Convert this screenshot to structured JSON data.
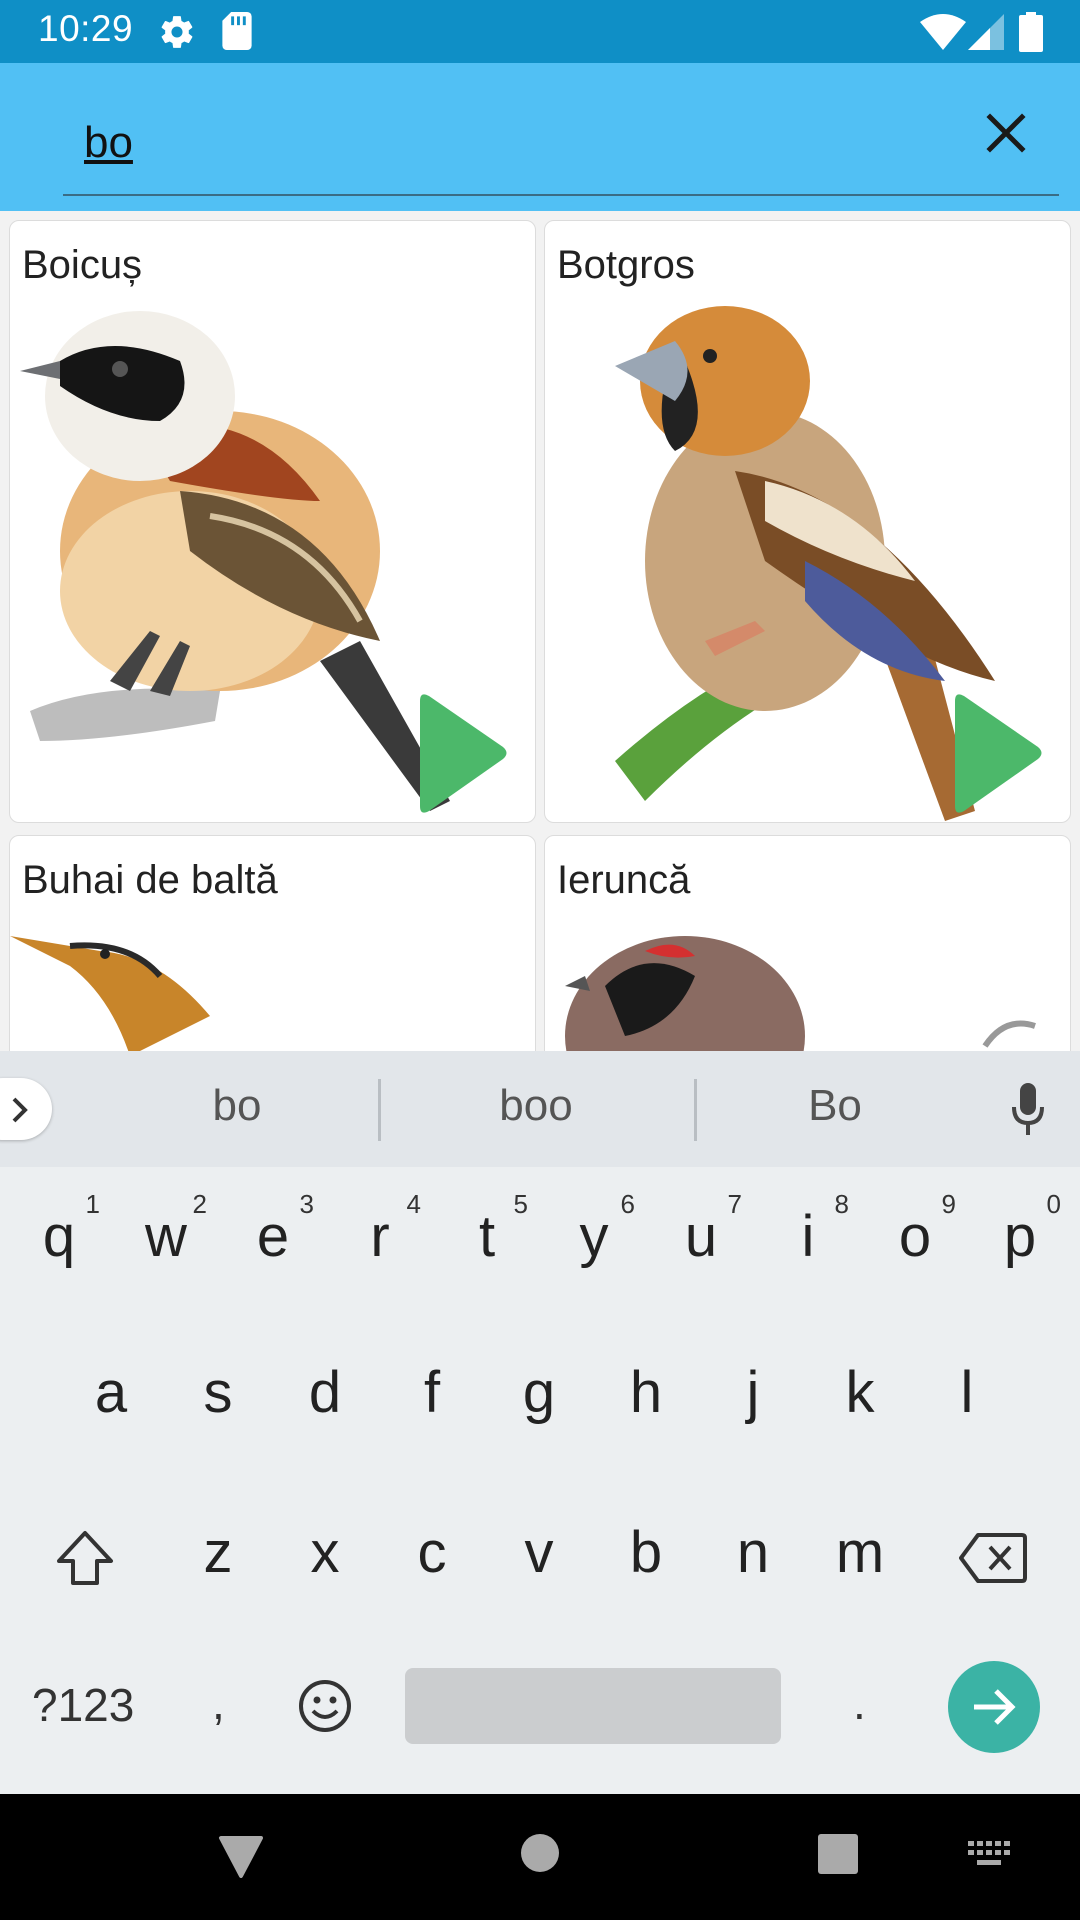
{
  "status": {
    "time": "10:29"
  },
  "search": {
    "value": "bo"
  },
  "birds": [
    {
      "name": "Boicuș"
    },
    {
      "name": "Botgros"
    },
    {
      "name": "Buhai de baltă"
    },
    {
      "name": "Ieruncă"
    }
  ],
  "keyboard": {
    "suggestions": [
      "bo",
      "boo",
      "Bo"
    ],
    "row1": [
      {
        "key": "q",
        "hint": "1"
      },
      {
        "key": "w",
        "hint": "2"
      },
      {
        "key": "e",
        "hint": "3"
      },
      {
        "key": "r",
        "hint": "4"
      },
      {
        "key": "t",
        "hint": "5"
      },
      {
        "key": "y",
        "hint": "6"
      },
      {
        "key": "u",
        "hint": "7"
      },
      {
        "key": "i",
        "hint": "8"
      },
      {
        "key": "o",
        "hint": "9"
      },
      {
        "key": "p",
        "hint": "0"
      }
    ],
    "row2": [
      "a",
      "s",
      "d",
      "f",
      "g",
      "h",
      "j",
      "k",
      "l"
    ],
    "row3": [
      "z",
      "x",
      "c",
      "v",
      "b",
      "n",
      "m"
    ],
    "symbols_label": "?123",
    "comma": ",",
    "period": "."
  },
  "colors": {
    "status_bar": "#0f8fc6",
    "app_bar": "#51c0f4",
    "play_button": "#4cb86a",
    "enter_key": "#3bb3a5"
  }
}
